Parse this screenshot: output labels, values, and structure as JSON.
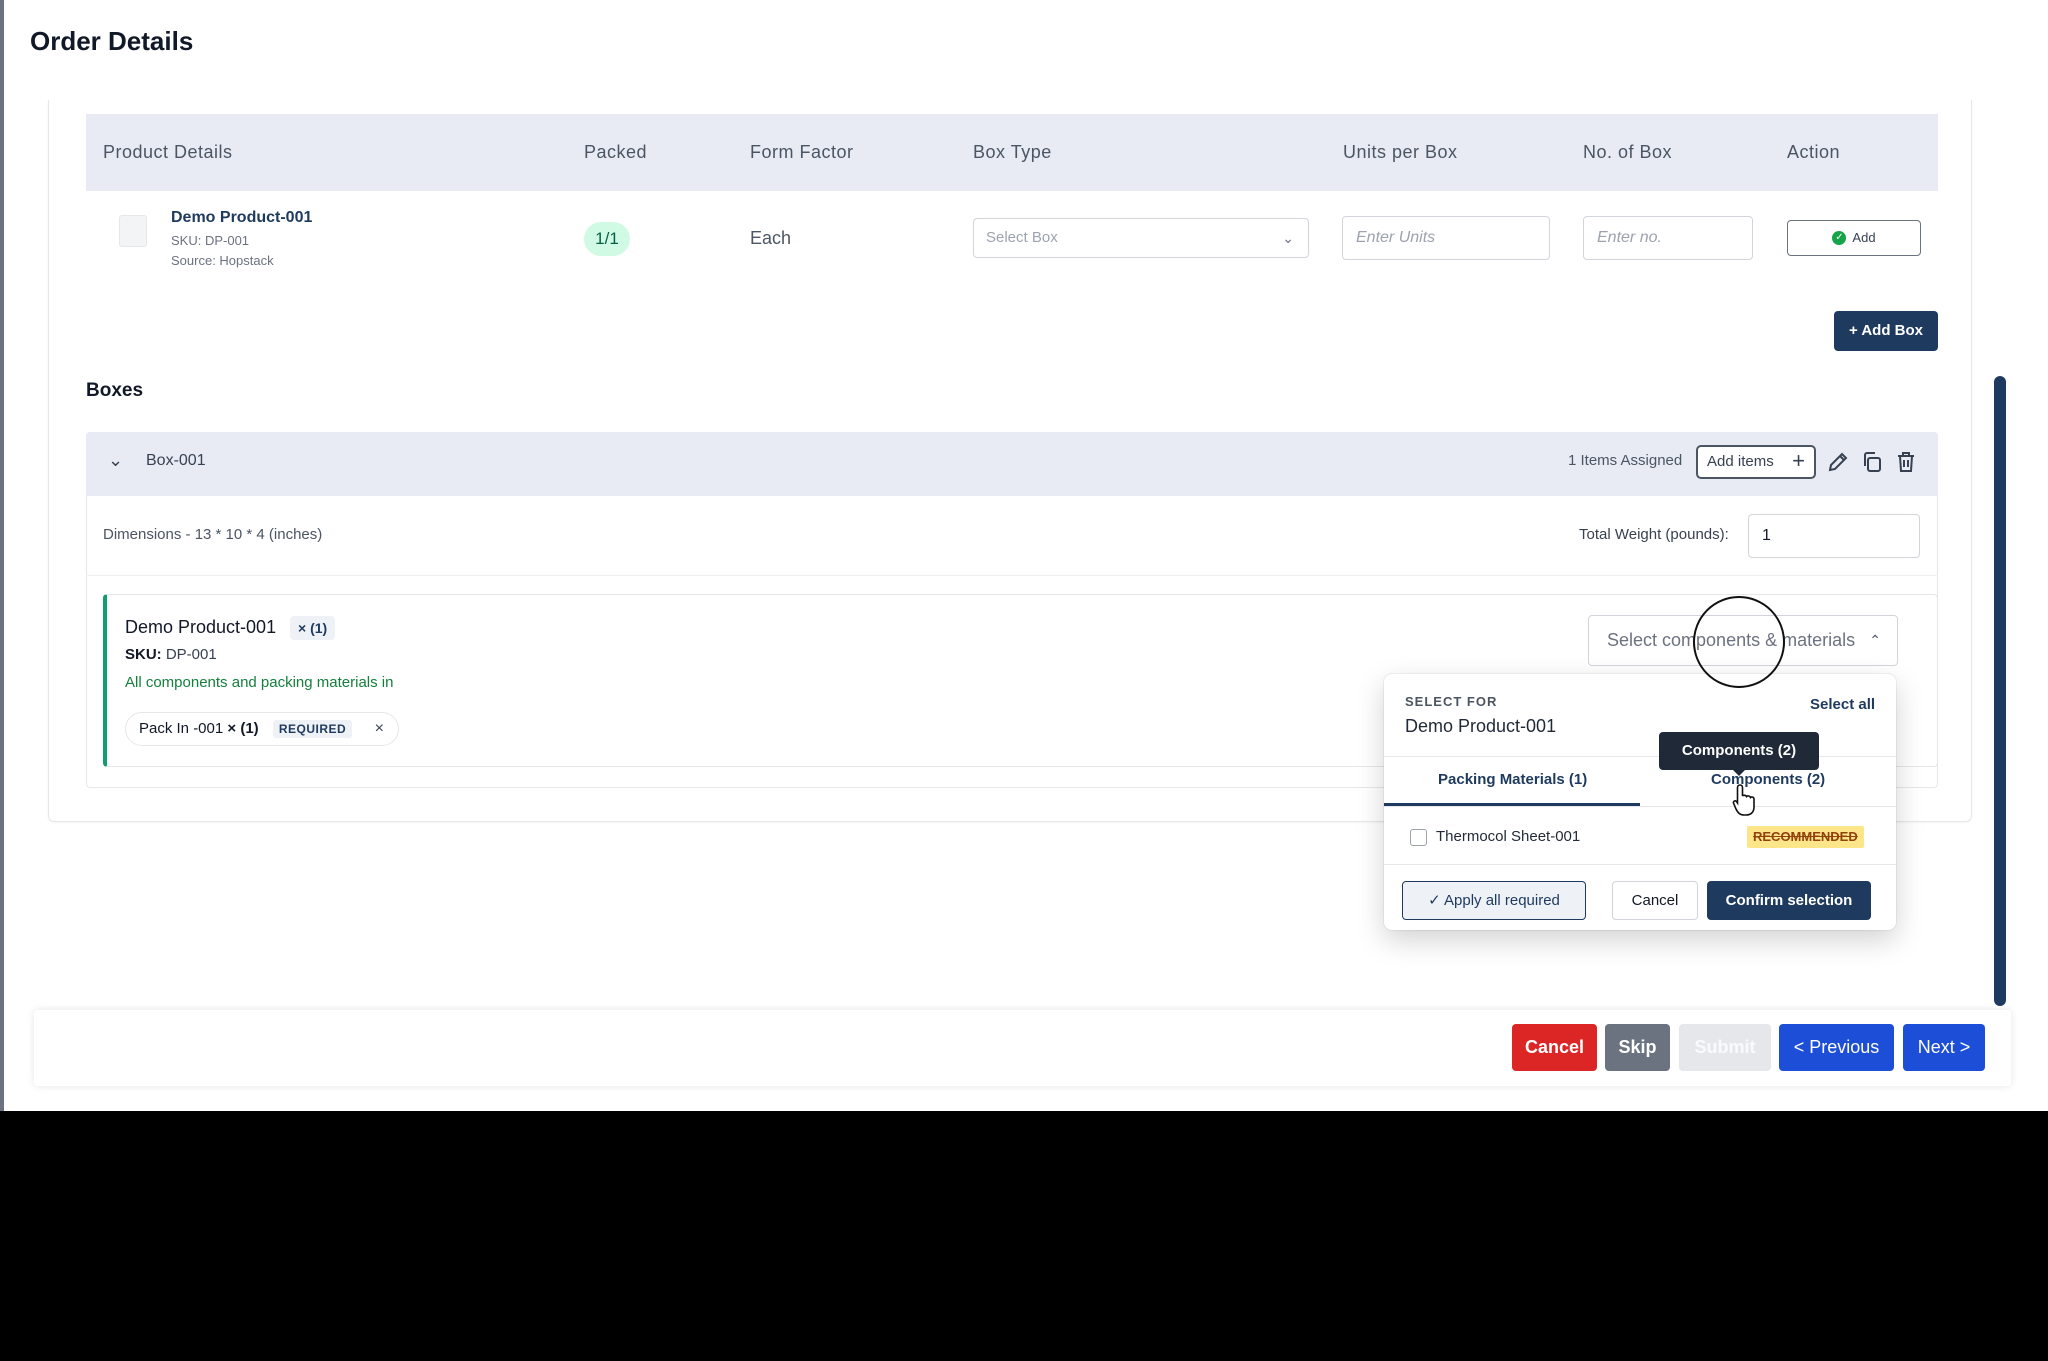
{
  "page": {
    "title": "Order Details"
  },
  "table": {
    "headers": [
      "Product Details",
      "Packed",
      "Form Factor",
      "Box Type",
      "Units per Box",
      "No. of Box",
      "Action"
    ],
    "row": {
      "product_name": "Demo Product-001",
      "sku": "SKU: DP-001",
      "source": "Source: Hopstack",
      "packed": "1/1",
      "form_factor": "Each",
      "box_type_placeholder": "Select Box",
      "units_placeholder": "Enter Units",
      "boxes_placeholder": "Enter no.",
      "action_label": "Add"
    },
    "add_box_label": "+ Add Box"
  },
  "boxes": {
    "title": "Boxes",
    "box": {
      "name": "Box-001",
      "items_assigned": "1 Items Assigned",
      "add_items_label": "Add items",
      "dimensions": "Dimensions - 13 * 10 * 4 (inches)",
      "weight_label": "Total Weight (pounds):",
      "weight_value": "1",
      "item": {
        "name": "Demo Product-001",
        "qty": "× (1)",
        "sku_label": "SKU:",
        "sku_value": "DP-001",
        "status": "All components and packing materials in",
        "chip_label": "Pack In -001",
        "chip_qty": "× (1)",
        "chip_required": "REQUIRED"
      },
      "component_select_placeholder": "Select components & materials"
    }
  },
  "dropdown": {
    "label": "SELECT FOR",
    "product": "Demo Product-001",
    "select_all": "Select all",
    "tabs": [
      "Packing Materials (1)",
      "Components (2)"
    ],
    "active_tab": "Packing Materials (1)",
    "options": [
      {
        "label": "Thermocol Sheet-001",
        "badge": "RECOMMENDED",
        "checked": false
      }
    ],
    "apply_label": "Apply all required",
    "cancel_label": "Cancel",
    "confirm_label": "Confirm selection",
    "tooltip": "Components (2)"
  },
  "footer": {
    "cancel": "Cancel",
    "skip": "Skip",
    "submit": "Submit",
    "previous": "< Previous",
    "next": "Next >"
  },
  "colors": {
    "primary": "#1e3a5f",
    "success": "#0f9f6e",
    "danger": "#dc2626",
    "blue": "#1d4ed8"
  }
}
